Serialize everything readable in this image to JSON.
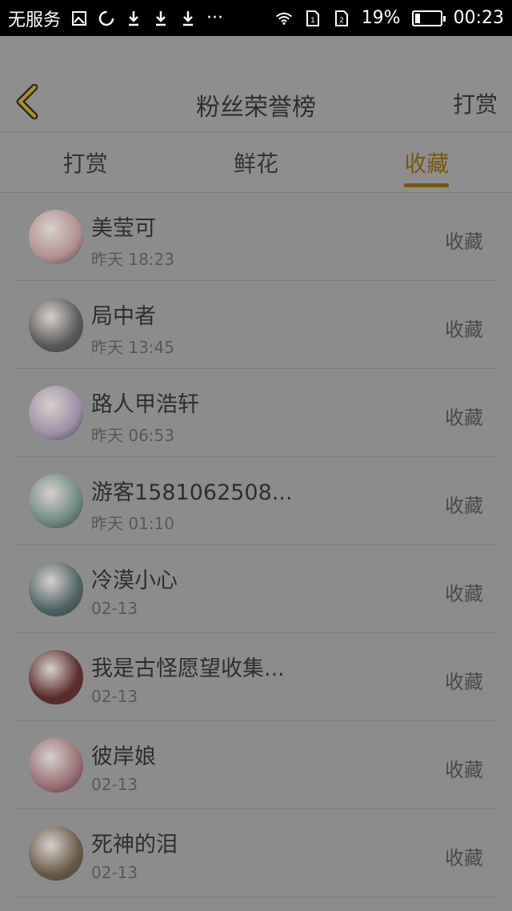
{
  "status_bar": {
    "carrier": "无服务",
    "more": "···",
    "battery_percent": "19%",
    "battery_level": 0.19,
    "time": "00:23"
  },
  "header": {
    "title": "粉丝荣誉榜",
    "action": "打赏",
    "back_icon": "chevron-left-icon",
    "accent_color": "#f5c518"
  },
  "tabs": [
    {
      "label": "打赏",
      "active": false
    },
    {
      "label": "鲜花",
      "active": false
    },
    {
      "label": "收藏",
      "active": true
    }
  ],
  "list": [
    {
      "name": "美莹可",
      "time": "昨天 18:23",
      "action": "收藏",
      "avatar_color": "#b38f8f"
    },
    {
      "name": "局中者",
      "time": "昨天 13:45",
      "action": "收藏",
      "avatar_color": "#5a5a5a"
    },
    {
      "name": "路人甲浩轩",
      "time": "昨天 06:53",
      "action": "收藏",
      "avatar_color": "#9f8fa8"
    },
    {
      "name": "游客1581062508...",
      "time": "昨天 01:10",
      "action": "收藏",
      "avatar_color": "#6f8a84"
    },
    {
      "name": "冷漠小心",
      "time": "02-13",
      "action": "收藏",
      "avatar_color": "#4f6466"
    },
    {
      "name": "我是古怪愿望收集...",
      "time": "02-13",
      "action": "收藏",
      "avatar_color": "#5b2b2b"
    },
    {
      "name": "彼岸娘",
      "time": "02-13",
      "action": "收藏",
      "avatar_color": "#9a6f75"
    },
    {
      "name": "死神的泪",
      "time": "02-13",
      "action": "收藏",
      "avatar_color": "#6b5a48"
    }
  ]
}
